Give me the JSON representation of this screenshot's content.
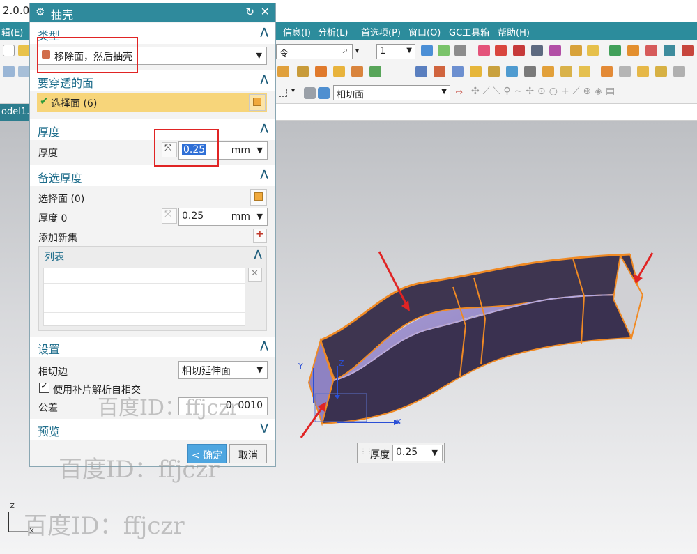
{
  "app": {
    "version_fragment": "2.0.0.2",
    "menus": [
      {
        "label": "辑(E)"
      },
      {
        "label": "信息(I)"
      },
      {
        "label": "分析(L)"
      },
      {
        "label": "首选项(P)"
      },
      {
        "label": "窗口(O)"
      },
      {
        "label": "GC工具箱"
      },
      {
        "label": "帮助(H)"
      }
    ],
    "command_search_fragment": "令",
    "search_icon": "magnifier-icon",
    "layer_value": "1",
    "snap_combo": "相切面",
    "model_tab": "odel1."
  },
  "dialog": {
    "title": "抽壳",
    "icon": "gear-icon",
    "reset_icon": "reset-icon",
    "close_icon": "close-icon",
    "type_section": {
      "title": "类型",
      "selected": "移除面，然后抽壳"
    },
    "pierce_section": {
      "title": "要穿透的面",
      "select_label": "选择面 (6)"
    },
    "thickness_section": {
      "title": "厚度",
      "label": "厚度",
      "value": "0.25",
      "unit": "mm"
    },
    "alt_section": {
      "title": "备选厚度",
      "select_label": "选择面 (0)",
      "thickness_label": "厚度 0",
      "thickness_value": "0.25",
      "unit": "mm",
      "add_set_label": "添加新集",
      "list_title": "列表"
    },
    "settings_section": {
      "title": "设置",
      "tangent_label": "相切边",
      "tangent_value": "相切延伸面",
      "patch_checkbox": "使用补片解析自相交",
      "patch_checked": true,
      "tolerance_label": "公差",
      "tolerance_value": "0. 0010"
    },
    "preview_section": {
      "title": "预览"
    },
    "ok_label": "< 确定 >",
    "cancel_label": "取消"
  },
  "viewport": {
    "popup_label": "厚度",
    "popup_value": "0.25",
    "axis_x": "X",
    "axis_y": "Y",
    "axis_z": "Z"
  },
  "watermark": {
    "text": "百度ID：ffjczr"
  },
  "colors": {
    "teal": "#2c8c9c",
    "accent_blue": "#1f6e8c",
    "highlight_row": "#f7d57a",
    "annotation_red": "#e02424",
    "body_purple": "#3e3550",
    "edge_orange": "#f08a24"
  }
}
